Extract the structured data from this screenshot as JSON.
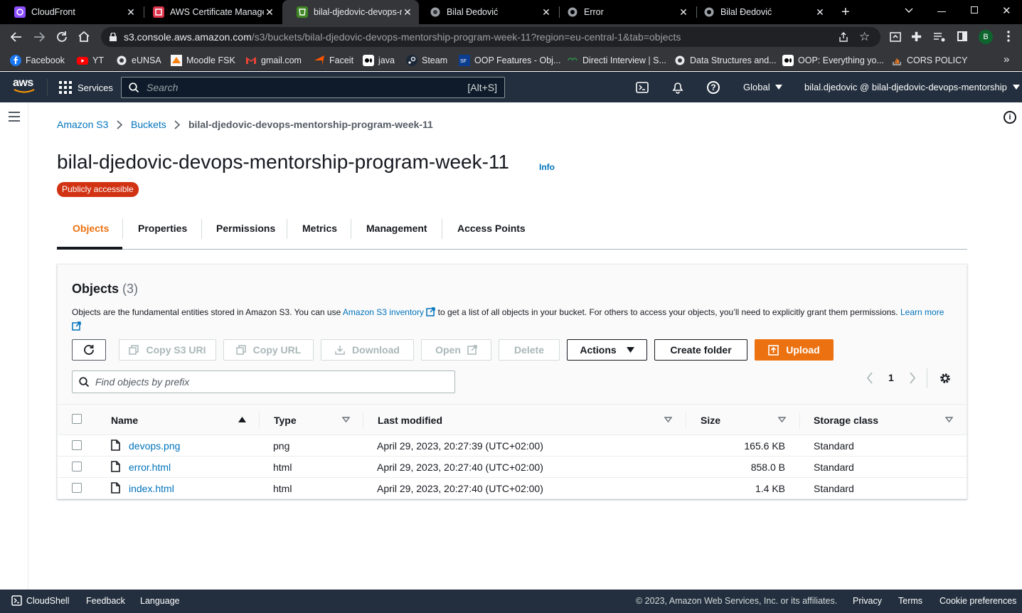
{
  "browser": {
    "tabs": [
      {
        "title": "CloudFront",
        "icon": "cloudfront-icon"
      },
      {
        "title": "AWS Certificate Manage",
        "icon": "acm-icon"
      },
      {
        "title": "bilal-djedovic-devops-m",
        "icon": "s3-icon"
      },
      {
        "title": "Bilal Đedović",
        "icon": "globe-icon"
      },
      {
        "title": "Error",
        "icon": "globe-icon"
      },
      {
        "title": "Bilal Đedović",
        "icon": "globe-icon"
      }
    ],
    "url_host": "s3.console.aws.amazon.com",
    "url_path": "/s3/buckets/bilal-djedovic-devops-mentorship-program-week-11?region=eu-central-1&tab=objects",
    "profile_initial": "B",
    "bookmarks": [
      "Facebook",
      "YT",
      "eUNSA",
      "Moodle FSK",
      "gmail.com",
      "Faceit",
      "java",
      "Steam",
      "OOP Features - Obj...",
      "Directi Interview | S...",
      "Data Structures and...",
      "OOP: Everything yo...",
      "CORS POLICY"
    ]
  },
  "aws_nav": {
    "logo": "aws",
    "services": "Services",
    "search_placeholder": "Search",
    "search_shortcut": "[Alt+S]",
    "region": "Global",
    "account": "bilal.djedovic @ bilal-djedovic-devops-mentorship"
  },
  "breadcrumb": [
    "Amazon S3",
    "Buckets",
    "bilal-djedovic-devops-mentorship-program-week-11"
  ],
  "page": {
    "title": "bilal-djedovic-devops-mentorship-program-week-11",
    "info": "Info",
    "badge": "Publicly accessible",
    "tabs": [
      "Objects",
      "Properties",
      "Permissions",
      "Metrics",
      "Management",
      "Access Points"
    ]
  },
  "objects": {
    "heading": "Objects",
    "count": "(3)",
    "desc_before": "Objects are the fundamental entities stored in Amazon S3. You can use",
    "desc_link": "Amazon S3 inventory",
    "desc_after": "to get a list of all objects in your bucket. For others to access your objects, you’ll need to explicitly grant them permissions.",
    "learn": "Learn",
    "more": "more",
    "buttons": {
      "copy_s3_uri": "Copy S3 URI",
      "copy_url": "Copy URL",
      "download": "Download",
      "open": "Open",
      "delete": "Delete",
      "actions": "Actions",
      "create_folder": "Create folder",
      "upload": "Upload"
    },
    "filter_placeholder": "Find objects by prefix",
    "page_number": "1",
    "columns": [
      "Name",
      "Type",
      "Last modified",
      "Size",
      "Storage class"
    ],
    "rows": [
      {
        "name": "devops.png",
        "type": "png",
        "modified": "April 29, 2023, 20:27:39 (UTC+02:00)",
        "size": "165.6 KB",
        "storage": "Standard"
      },
      {
        "name": "error.html",
        "type": "html",
        "modified": "April 29, 2023, 20:27:40 (UTC+02:00)",
        "size": "858.0 B",
        "storage": "Standard"
      },
      {
        "name": "index.html",
        "type": "html",
        "modified": "April 29, 2023, 20:27:40 (UTC+02:00)",
        "size": "1.4 KB",
        "storage": "Standard"
      }
    ]
  },
  "footer": {
    "cloudshell": "CloudShell",
    "feedback": "Feedback",
    "language": "Language",
    "copyright": "© 2023, Amazon Web Services, Inc. or its affiliates.",
    "privacy": "Privacy",
    "terms": "Terms",
    "cookies": "Cookie preferences"
  },
  "colors": {
    "accent": "#ec7211",
    "link": "#0073bb",
    "nav": "#232f3e",
    "badge": "#d13212"
  }
}
